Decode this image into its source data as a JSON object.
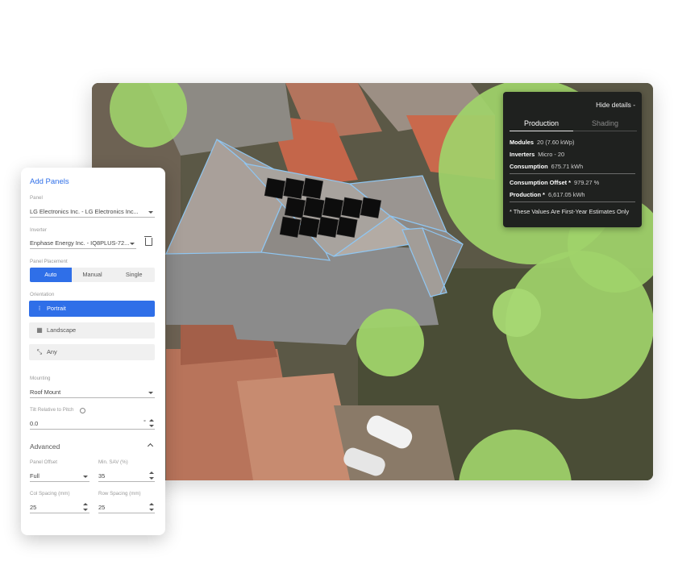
{
  "details": {
    "hide_label": "Hide details -",
    "tabs": [
      "Production",
      "Shading"
    ],
    "modules_label": "Modules",
    "modules_value": "20 (7.60 kWp)",
    "inverters_label": "Inverters",
    "inverters_value": "Micro - 20",
    "consumption_label": "Consumption",
    "consumption_value": "675.71 kWh",
    "offset_label": "Consumption Offset *",
    "offset_value": "979.27 %",
    "production_label": "Production *",
    "production_value": "6,617.05 kWh",
    "note": "* These Values Are First-Year Estimates Only"
  },
  "panel": {
    "title": "Add Panels",
    "panel_label": "Panel",
    "panel_value": "LG Electronics Inc. - LG Electronics Inc...",
    "inverter_label": "Inverter",
    "inverter_value": "Enphase Energy Inc. - IQ8PLUS-72...",
    "placement_label": "Panel Placement",
    "placement_options": [
      "Auto",
      "Manual",
      "Single"
    ],
    "orientation_label": "Orientation",
    "orientation_options": [
      "Portrait",
      "Landscape",
      "Any"
    ],
    "mounting_label": "Mounting",
    "mounting_value": "Roof Mount",
    "tilt_label": "Tilt Relative to Pitch",
    "tilt_value": "0.0",
    "tilt_unit": "°",
    "advanced_label": "Advanced",
    "panel_offset_label": "Panel Offset",
    "panel_offset_value": "Full",
    "min_sav_label": "Min. SAV (%)",
    "min_sav_value": "35",
    "col_spacing_label": "Col Spacing (mm)",
    "col_spacing_value": "25",
    "row_spacing_label": "Row Spacing (mm)",
    "row_spacing_value": "25"
  },
  "colors": {
    "accent": "#2f6fe8",
    "tree": "#9fd36a",
    "overlay_bg": "#1f211f"
  }
}
